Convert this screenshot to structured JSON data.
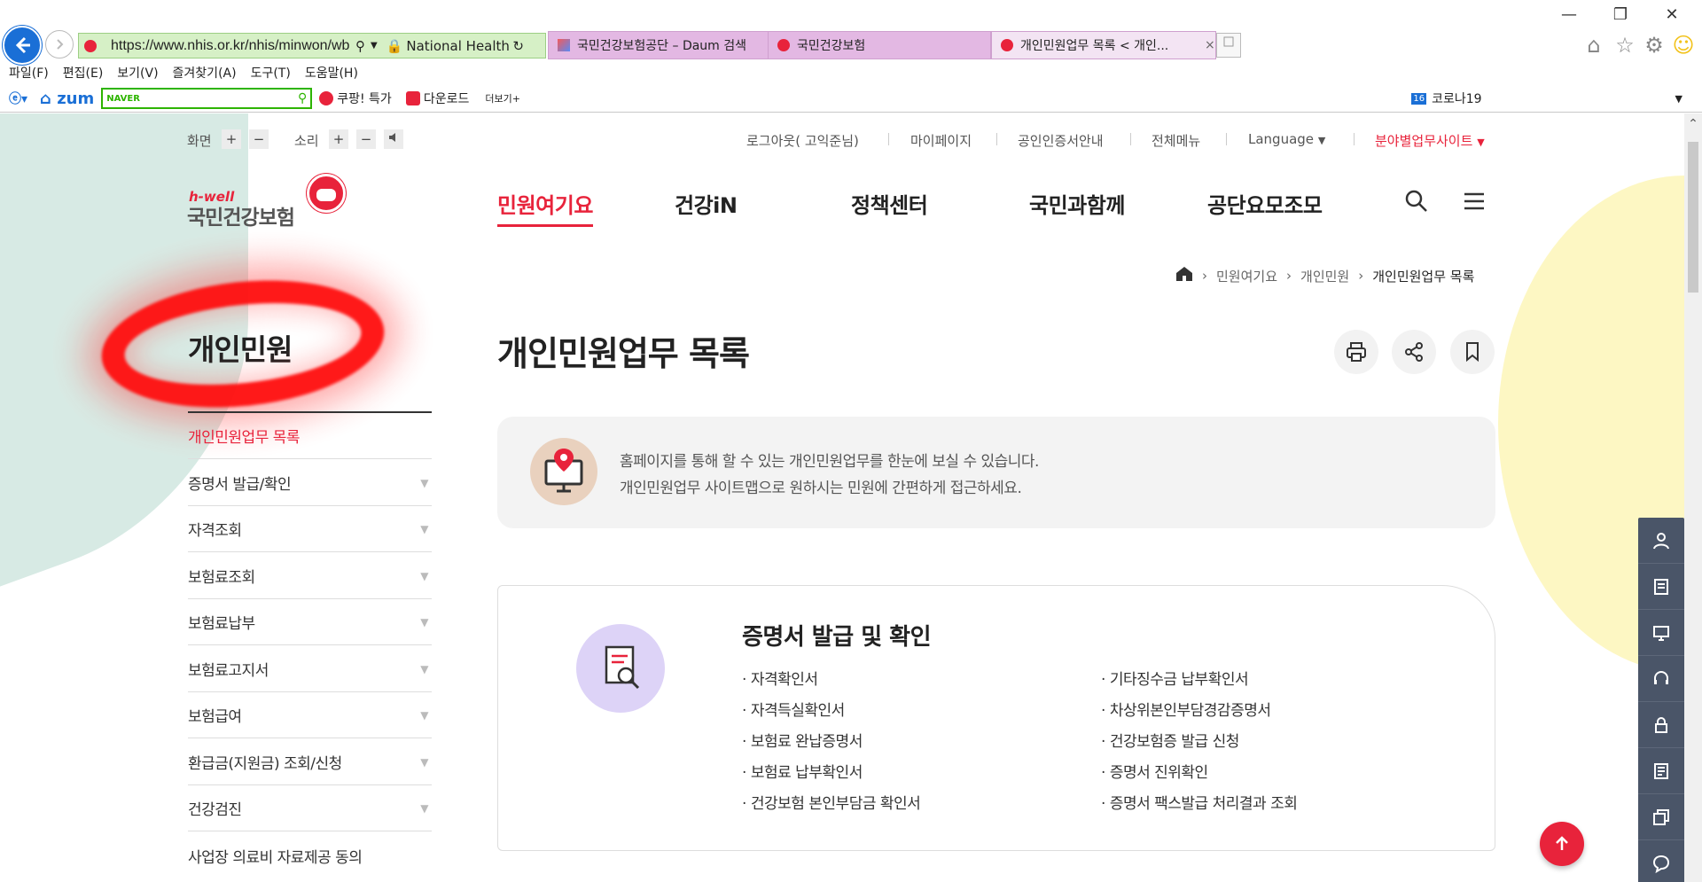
{
  "browser": {
    "url": "https://www.nhis.or.kr/nhis/minwon/wb",
    "site_identity": "National Health...",
    "tabs": [
      {
        "label": "국민건강보험공단 – Daum 검색"
      },
      {
        "label": "국민건강보험"
      },
      {
        "label": "개인민원업무 목록 < 개인...",
        "close": "×"
      }
    ],
    "menu": [
      "파일(F)",
      "편집(E)",
      "보기(V)",
      "즐겨찾기(A)",
      "도구(T)",
      "도움말(H)"
    ],
    "favorites": {
      "zum": "zum",
      "naver": "NAVER",
      "coupang": "쿠팡! 특가",
      "download": "다운로드",
      "more": "더보기+",
      "corona_badge": "16",
      "corona": "코로나19"
    }
  },
  "util": {
    "screen": "화면",
    "sound": "소리",
    "plus": "+",
    "minus": "−",
    "logout": "로그아웃( 고익준님)",
    "mypage": "마이페이지",
    "cert": "공인인증서안내",
    "allmenu": "전체메뉴",
    "language": "Language",
    "sites": "분야별업무사이트"
  },
  "logo": {
    "top": "h-well",
    "main": "국민건강보험"
  },
  "gnb": [
    "민원여기요",
    "건강iN",
    "정책센터",
    "국민과함께",
    "공단요모조모"
  ],
  "breadcrumb": [
    "민원여기요",
    "개인민원",
    "개인민원업무 목록"
  ],
  "lnb": {
    "title": "개인민원",
    "items": [
      "개인민원업무 목록",
      "증명서 발급/확인",
      "자격조회",
      "보험료조회",
      "보험료납부",
      "보험료고지서",
      "보험급여",
      "환급금(지원금) 조회/신청",
      "건강검진",
      "사업장 의료비 자료제공 동의"
    ]
  },
  "main": {
    "title": "개인민원업무 목록",
    "intro": [
      "홈페이지를 통해 할 수 있는 개인민원업무를 한눈에 보실 수 있습니다.",
      "개인민원업무 사이트맵으로 원하시는 민원에 간편하게 접근하세요."
    ],
    "card": {
      "title": "증명서 발급 및 확인",
      "left": [
        "자격확인서",
        "자격득실확인서",
        "보험료 완납증명서",
        "보험료 납부확인서",
        "건강보험 본인부담금 확인서"
      ],
      "right": [
        "기타징수금 납부확인서",
        "차상위본인부담경감증명서",
        "건강보험증 발급 신청",
        "증명서 진위확인",
        "증명서 팩스발급 처리결과 조회"
      ]
    }
  },
  "colors": {
    "brand_red": "#e8233b",
    "side_panel": "#4a5568"
  }
}
